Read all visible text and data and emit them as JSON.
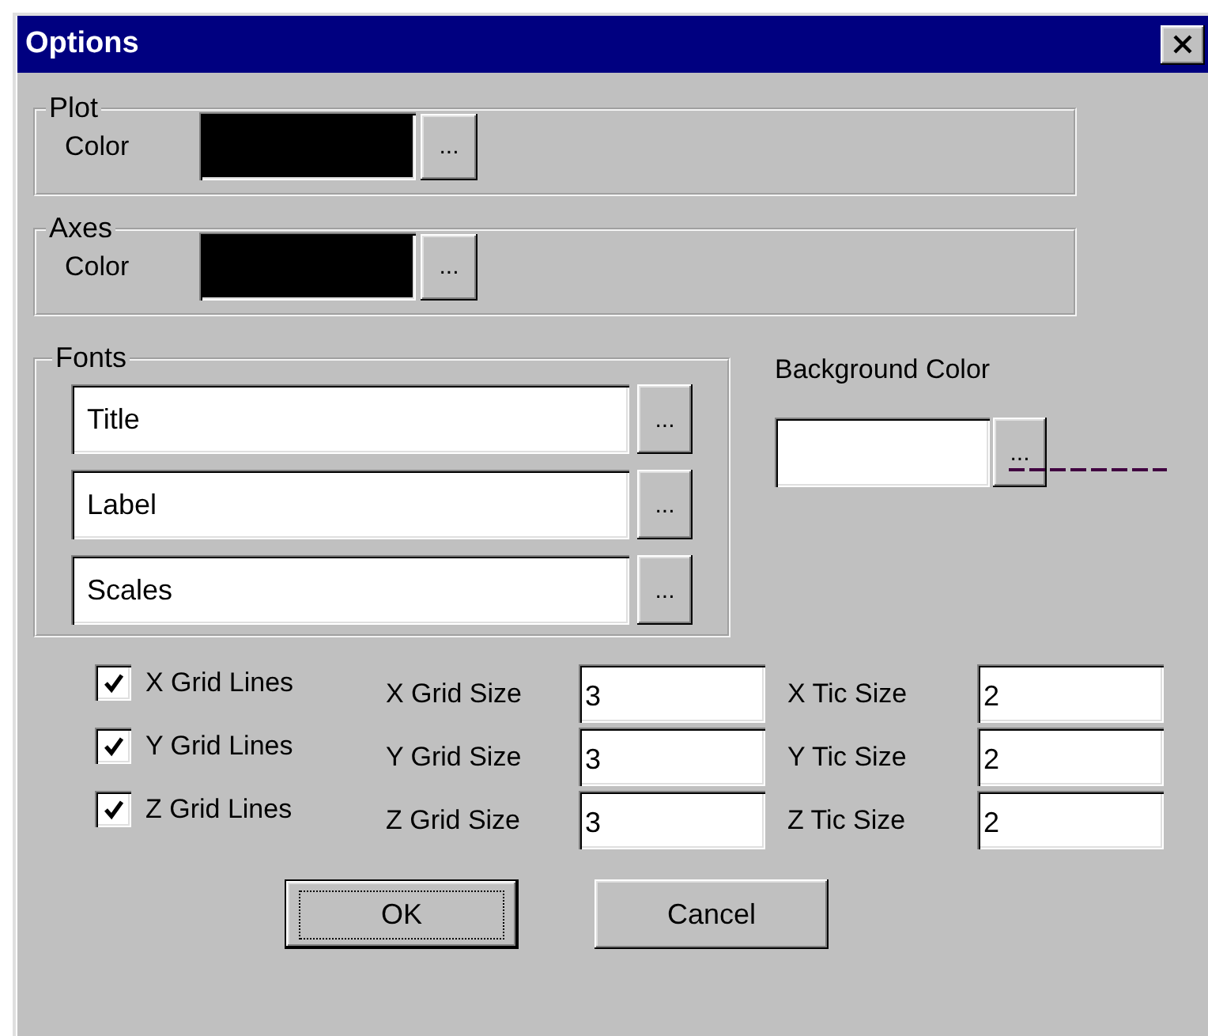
{
  "window": {
    "title": "Options"
  },
  "color_groups": [
    {
      "title": "Plot",
      "label": "Color",
      "color": "#000000",
      "button": "..."
    },
    {
      "title": "Axes",
      "label": "Color",
      "color": "#000000",
      "button": "..."
    }
  ],
  "fonts": {
    "title": "Fonts",
    "fields": [
      {
        "value": "Title",
        "button": "..."
      },
      {
        "value": "Label",
        "button": "..."
      },
      {
        "value": "Scales",
        "button": "..."
      }
    ]
  },
  "background": {
    "label": "Background Color",
    "color": "#ffffff",
    "button": "..."
  },
  "grid_rows": [
    {
      "checkbox_label": "X Grid Lines",
      "checked": true,
      "grid_size_label": "X Grid Size",
      "grid_size": "3",
      "tic_size_label": "X Tic Size",
      "tic_size": "2"
    },
    {
      "checkbox_label": "Y Grid Lines",
      "checked": true,
      "grid_size_label": "Y Grid Size",
      "grid_size": "3",
      "tic_size_label": "Y Tic Size",
      "tic_size": "2"
    },
    {
      "checkbox_label": "Z Grid Lines",
      "checked": true,
      "grid_size_label": "Z Grid Size",
      "grid_size": "3",
      "tic_size_label": "Z Tic Size",
      "tic_size": "2"
    }
  ],
  "buttons": [
    {
      "label": "OK",
      "focused": true
    },
    {
      "label": "Cancel",
      "focused": false
    }
  ]
}
